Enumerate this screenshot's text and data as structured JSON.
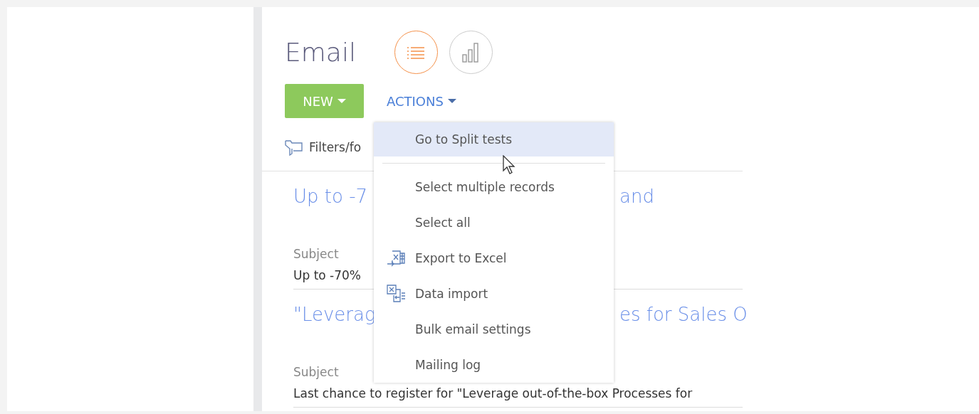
{
  "header": {
    "title": "Email",
    "view_buttons": [
      {
        "kind": "list",
        "selected": true
      },
      {
        "kind": "chart",
        "selected": false
      }
    ]
  },
  "toolbar": {
    "new_button": "NEW",
    "actions_button": "ACTIONS"
  },
  "filters": {
    "label": "Filters/fo"
  },
  "records": [
    {
      "title_left": "Up to -7",
      "title_right": "and",
      "field_label": "Subject",
      "field_value": "Up to -70%"
    },
    {
      "title_left": "\"Leverag",
      "title_right": "es for Sales O",
      "field_label": "Subject",
      "field_value": "Last chance to register for \"Leverage out-of-the-box Processes for"
    }
  ],
  "actions_menu": {
    "items": [
      {
        "label": "Go to Split tests",
        "kind": "plain",
        "selected": true,
        "separator_after": true
      },
      {
        "label": "Select multiple records",
        "kind": "plain",
        "selected": false
      },
      {
        "label": "Select all",
        "kind": "plain",
        "selected": false
      },
      {
        "label": "Export to Excel",
        "kind": "export",
        "selected": false
      },
      {
        "label": "Data import",
        "kind": "import",
        "selected": false
      },
      {
        "label": "Bulk email settings",
        "kind": "plain",
        "selected": false
      },
      {
        "label": "Mailing log",
        "kind": "plain",
        "selected": false
      }
    ]
  }
}
